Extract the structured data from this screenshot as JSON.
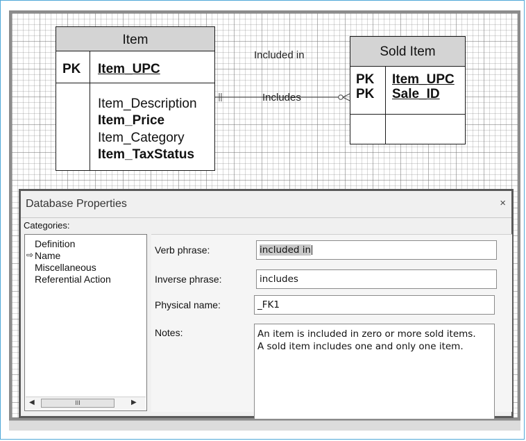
{
  "diagram": {
    "item": {
      "title": "Item",
      "pk_label": "PK",
      "pk_field": "Item_UPC",
      "fields": [
        {
          "name": "Item_Description",
          "bold": false
        },
        {
          "name": "Item_Price",
          "bold": true
        },
        {
          "name": "Item_Category",
          "bold": false
        },
        {
          "name": "Item_TaxStatus",
          "bold": true
        }
      ]
    },
    "sold_item": {
      "title": "Sold Item",
      "pk_labels": [
        "PK",
        "PK"
      ],
      "pk_fields": [
        "Item_UPC",
        "Sale_ID"
      ]
    },
    "relationship": {
      "top_label": "Included in",
      "bottom_label": "Includes"
    }
  },
  "dialog": {
    "title": "Database Properties",
    "close": "×",
    "categories_label": "Categories:",
    "categories": [
      "Definition",
      "Name",
      "Miscellaneous",
      "Referential Action"
    ],
    "selected_category": "Name",
    "selected_marker": "⇨",
    "scroll_thumb": "III",
    "scroll_left": "◀",
    "scroll_right": "▶",
    "fields": {
      "verb_phrase_label": "Verb phrase:",
      "verb_phrase_value": "included in",
      "inverse_phrase_label": "Inverse phrase:",
      "inverse_phrase_value": "includes",
      "physical_name_label": "Physical name:",
      "physical_name_value": "_FK1",
      "notes_label": "Notes:",
      "notes_lines": [
        "An item is included in zero or more sold items.",
        "A sold item includes one and only one item."
      ]
    }
  }
}
